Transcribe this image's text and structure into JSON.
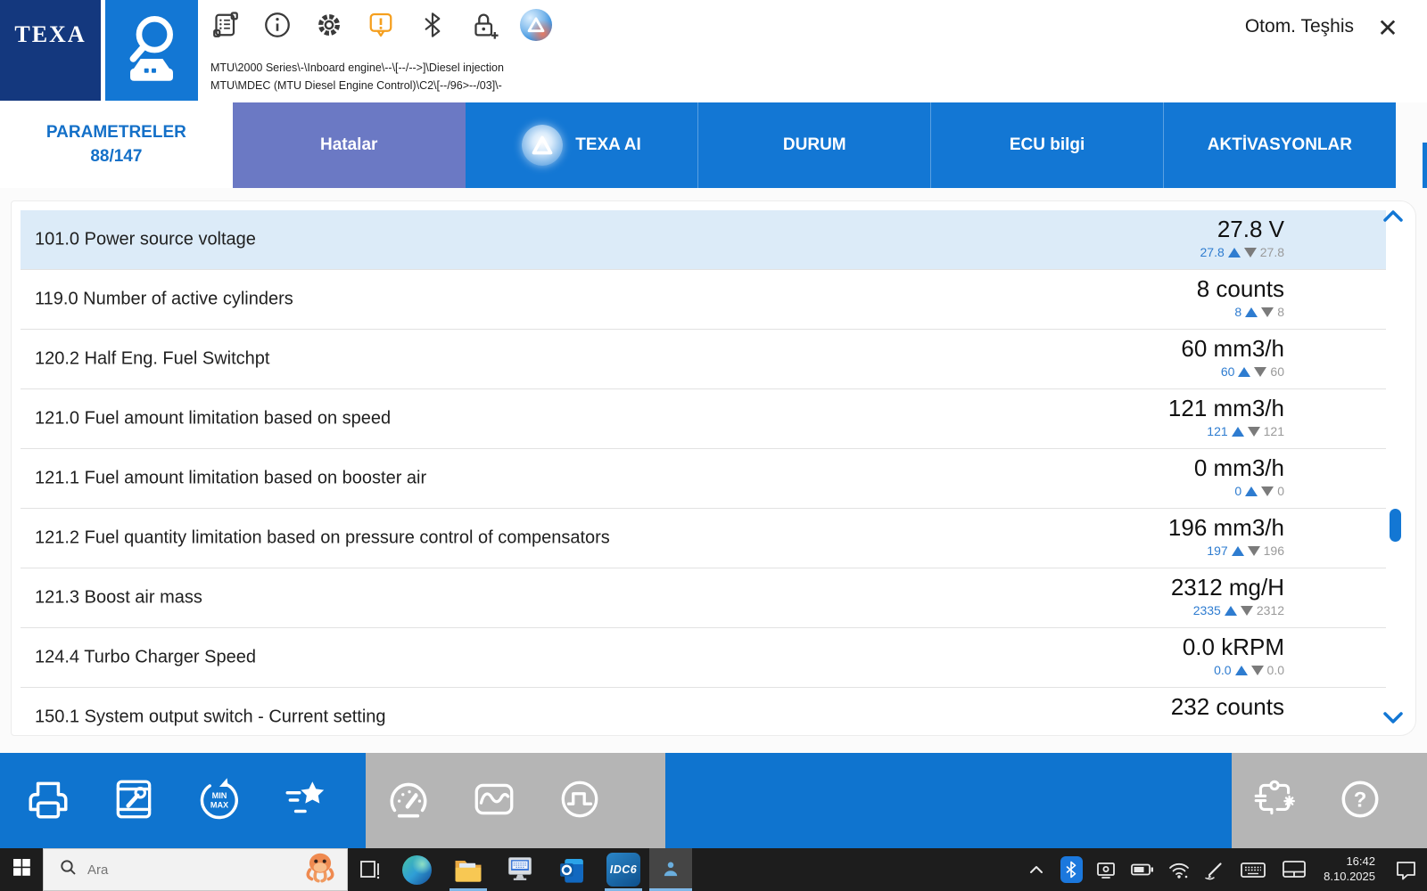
{
  "window": {
    "app_title": "Otom. Teşhis",
    "close_label": "✕"
  },
  "header": {
    "logo_text": "TEXA",
    "breadcrumb_line1": "MTU\\2000 Series\\-\\Inboard engine\\--\\[--/-->]\\Diesel injection",
    "breadcrumb_line2": "MTU\\MDEC (MTU Diesel Engine Control)\\C2\\[--/96>--/03]\\-"
  },
  "tabs": {
    "parameters_label": "PARAMETRELER",
    "parameters_count": "88/147",
    "hatalar": "Hatalar",
    "texa_ai": "TEXA AI",
    "durum": "DURUM",
    "ecu": "ECU bilgi",
    "aktivasyonlar": "AKTİVASYONLAR"
  },
  "parameters": {
    "rows": [
      {
        "label": "101.0 Power source voltage",
        "value": "27.8 V",
        "stat_left": "27.8",
        "stat_right": "27.8"
      },
      {
        "label": "119.0 Number of active cylinders",
        "value": "8 counts",
        "stat_left": "8",
        "stat_right": "8"
      },
      {
        "label": "120.2 Half Eng. Fuel Switchpt",
        "value": "60 mm3/h",
        "stat_left": "60",
        "stat_right": "60"
      },
      {
        "label": "121.0 Fuel amount limitation based on speed",
        "value": "121 mm3/h",
        "stat_left": "121",
        "stat_right": "121"
      },
      {
        "label": "121.1 Fuel amount limitation based on booster air",
        "value": "0 mm3/h",
        "stat_left": "0",
        "stat_right": "0"
      },
      {
        "label": "121.2 Fuel quantity limitation based on pressure control of compensators",
        "value": "196 mm3/h",
        "stat_left": "197",
        "stat_right": "196"
      },
      {
        "label": "121.3 Boost air mass",
        "value": "2312 mg/H",
        "stat_left": "2335",
        "stat_right": "2312"
      },
      {
        "label": "124.4 Turbo Charger Speed",
        "value": "0.0 kRPM",
        "stat_left": "0.0",
        "stat_right": "0.0"
      },
      {
        "label": "150.1 System output switch - Current setting",
        "value": "232 counts",
        "stat_left": "",
        "stat_right": ""
      }
    ]
  },
  "toolbar": {
    "minmax_line1": "MIN",
    "minmax_line2": "MAX",
    "help_glyph": "?"
  },
  "taskbar": {
    "search_placeholder": "Ara",
    "idc6_label": "IDC6",
    "time": "16:42",
    "date": "8.10.2025"
  },
  "colors": {
    "navy": "#14387e",
    "blue": "#1377d4",
    "slate_tab": "#6b79c4",
    "selected_row": "#dcebf8",
    "stat_blue": "#2e7cd0",
    "warning_orange": "#f59f1e",
    "toolbar_blue": "#0f74cf",
    "toolbar_gray": "#b5b5b5",
    "taskbar": "#1d1d1d"
  }
}
